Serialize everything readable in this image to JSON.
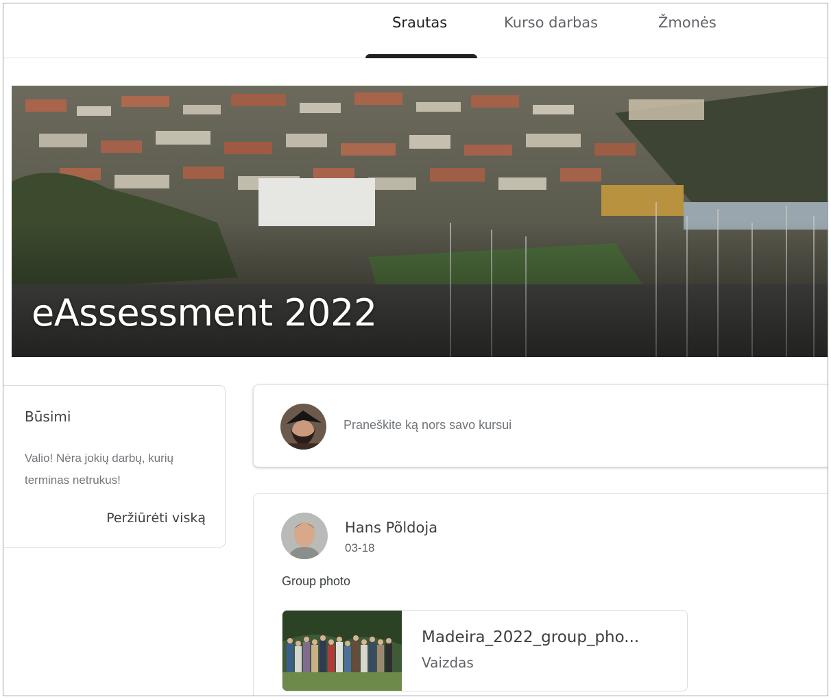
{
  "nav": {
    "tabs": [
      {
        "label": "Srautas",
        "active": true
      },
      {
        "label": "Kurso darbas",
        "active": false
      },
      {
        "label": "Žmonės",
        "active": false
      }
    ]
  },
  "banner": {
    "title": "eAssessment 2022"
  },
  "upcoming": {
    "title": "Būsimi",
    "message": "Valio! Nėra jokių darbų, kurių terminas netrukus!",
    "view_all": "Peržiūrėti viską"
  },
  "announce": {
    "placeholder": "Praneškite ką nors savo kursui"
  },
  "post": {
    "author": "Hans Põldoja",
    "date": "03-18",
    "text": "Group photo",
    "attachment": {
      "name": "Madeira_2022_group_pho...",
      "type": "Vaizdas"
    }
  },
  "colors": {
    "accent": "#202124",
    "border": "#dadce0",
    "muted": "#70757a"
  }
}
